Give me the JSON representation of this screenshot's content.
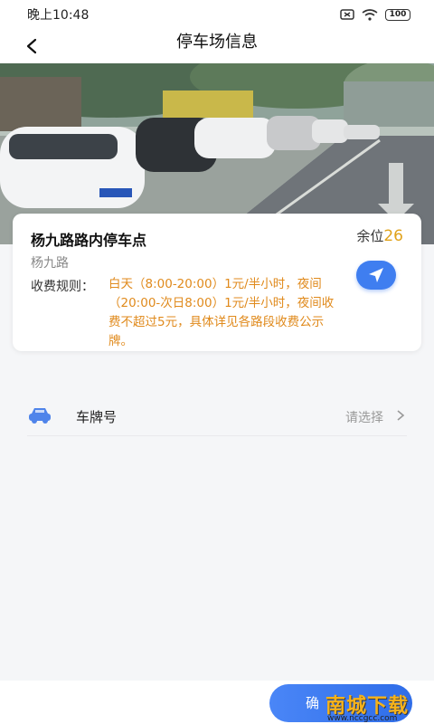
{
  "status_bar": {
    "time": "晚上10:48",
    "battery": "100"
  },
  "header": {
    "title": "停车场信息"
  },
  "lot": {
    "name": "杨九路路内停车点",
    "spaces_label": "余位",
    "spaces_count": "26",
    "road": "杨九路",
    "rules_label": "收费规则：",
    "rules_text": "白天（8:00-20:00）1元/半小时，夜间（20:00-次日8:00）1元/半小时，夜间收费不超过5元，具体详见各路段收费公示牌。"
  },
  "plate": {
    "label": "车牌号",
    "placeholder": "请选择"
  },
  "footer": {
    "confirm_label": "确"
  },
  "watermark": {
    "text": "南城下载",
    "url": "www.nccgcc.com"
  },
  "icons": {
    "back": "back-arrow-icon",
    "navigate": "navigation-arrow-icon",
    "car": "car-icon",
    "chevron": "chevron-right-icon"
  },
  "colors": {
    "accent": "#3f7ef0",
    "price": "#e08a1c",
    "spaces": "#e0a21a"
  }
}
